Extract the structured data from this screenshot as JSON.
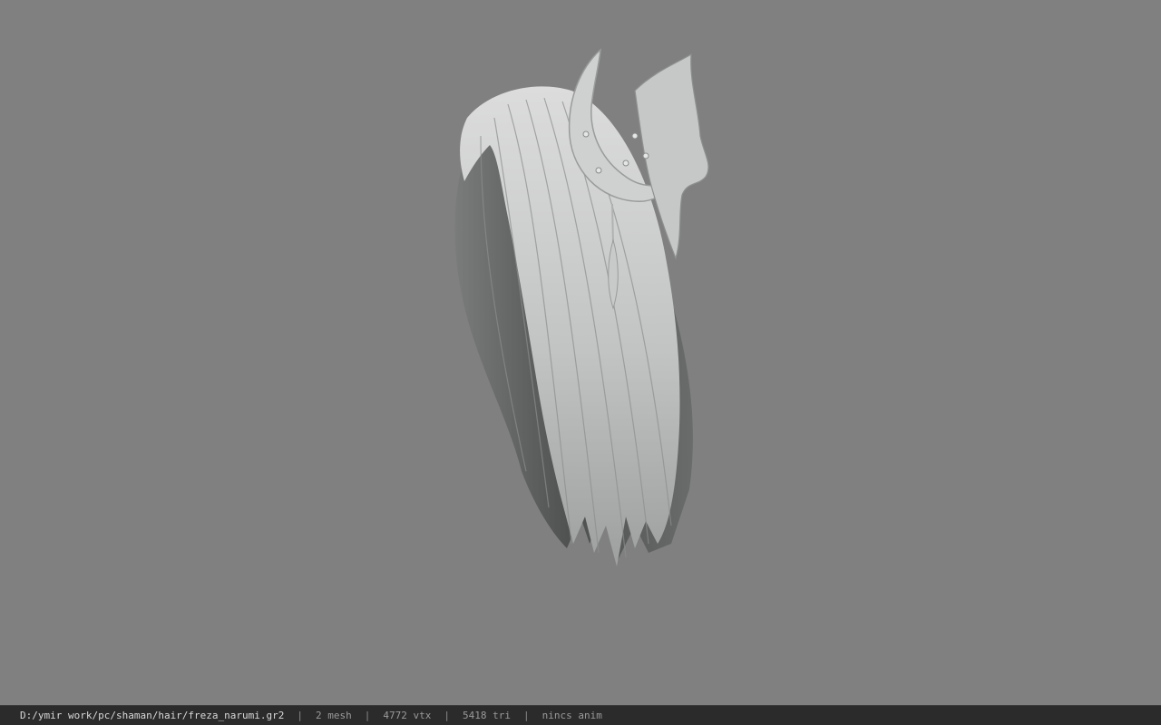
{
  "viewer": {
    "background_color": "#808080",
    "model_icon": "hair-mesh-icon"
  },
  "status": {
    "file_path": "D:/ymir work/pc/shaman/hair/freza_narumi.gr2",
    "separator": "|",
    "mesh_count": "2 mesh",
    "vertex_count": "4772 vtx",
    "triangle_count": "5418 tri",
    "anim_status": "nincs anim"
  }
}
